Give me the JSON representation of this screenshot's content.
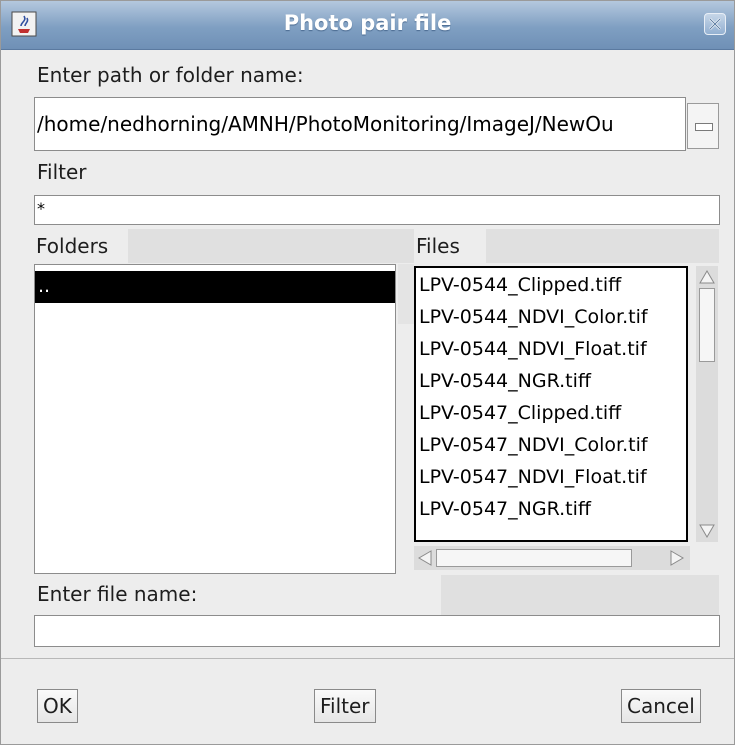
{
  "window": {
    "title": "Photo pair file"
  },
  "path": {
    "label": "Enter path or folder name:",
    "value": "/home/nedhorning/AMNH/PhotoMonitoring/ImageJ/NewOu"
  },
  "filter": {
    "label": "Filter",
    "value": "*"
  },
  "folders": {
    "label": "Folders",
    "items": [
      ".."
    ]
  },
  "files": {
    "label": "Files",
    "items": [
      "LPV-0544_Clipped.tiff",
      "LPV-0544_NDVI_Color.tif",
      "LPV-0544_NDVI_Float.tif",
      "LPV-0544_NGR.tiff",
      "LPV-0547_Clipped.tiff",
      "LPV-0547_NDVI_Color.tif",
      "LPV-0547_NDVI_Float.tif",
      "LPV-0547_NGR.tiff"
    ]
  },
  "filename": {
    "label": "Enter file name:",
    "value": ""
  },
  "buttons": {
    "ok": "OK",
    "filter": "Filter",
    "cancel": "Cancel"
  }
}
